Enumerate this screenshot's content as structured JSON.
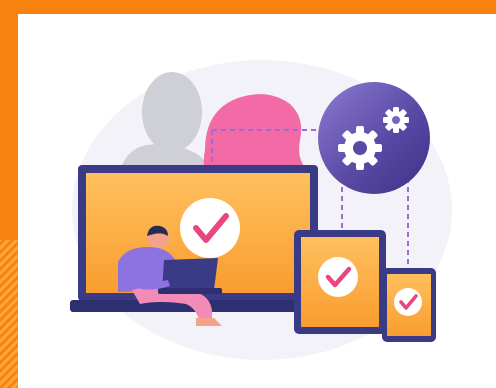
{
  "colors": {
    "frame_orange": "#F7820F",
    "frame_orange_light": "#FFB04A",
    "background": "#FFFFFF",
    "halo": "#F1F0F8",
    "silhouette": "#CFCFD7",
    "pink_blob": "#F26AA6",
    "device_body": "#3A3B86",
    "screen_orange": "#F99D2F",
    "screen_orange_light": "#FFC05E",
    "check_circle": "#FFFFFF",
    "check_mark": "#E8467F",
    "gear_circle": "#4A3A93",
    "gear_circle_light": "#8E7CD4",
    "gear": "#FFFFFF",
    "dashed_line": "#9B6BD9",
    "person_shirt": "#8C73E0",
    "person_pants": "#F28BB8",
    "skin": "#F2A38A",
    "hair": "#2A2A55"
  },
  "icons": {
    "gear": "gear-icon",
    "check": "checkmark-icon"
  }
}
